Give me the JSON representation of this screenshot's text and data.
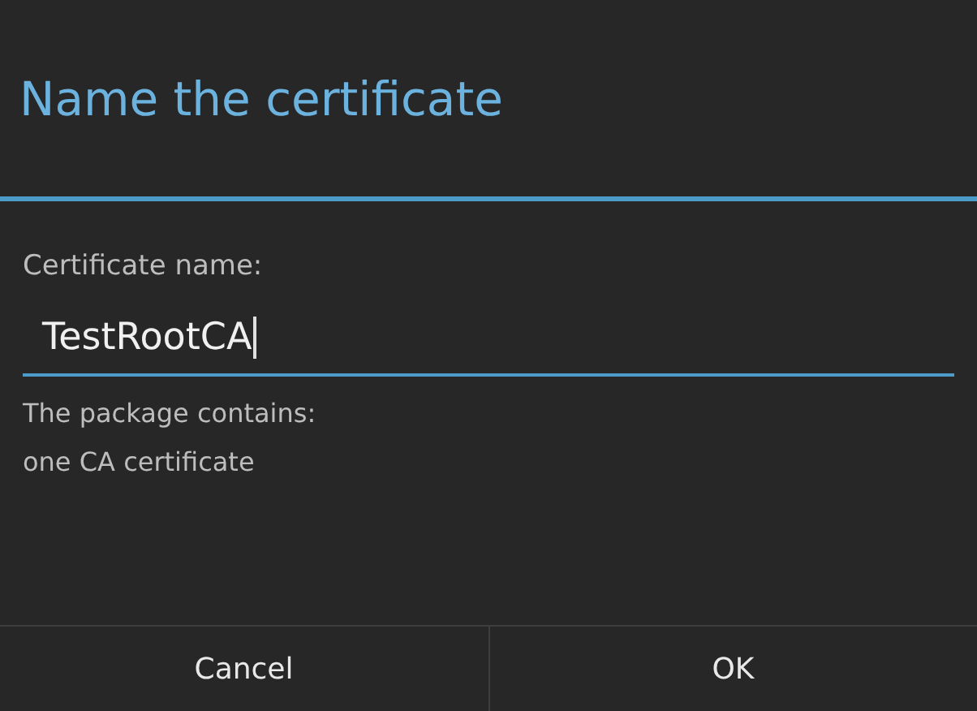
{
  "dialog": {
    "title": "Name the certificate"
  },
  "field": {
    "label": "Certificate name:",
    "value": "TestRootCA",
    "focused": true
  },
  "message": [
    "The package contains:",
    "one CA certificate"
  ],
  "buttons": [
    "Cancel",
    "OK"
  ]
}
